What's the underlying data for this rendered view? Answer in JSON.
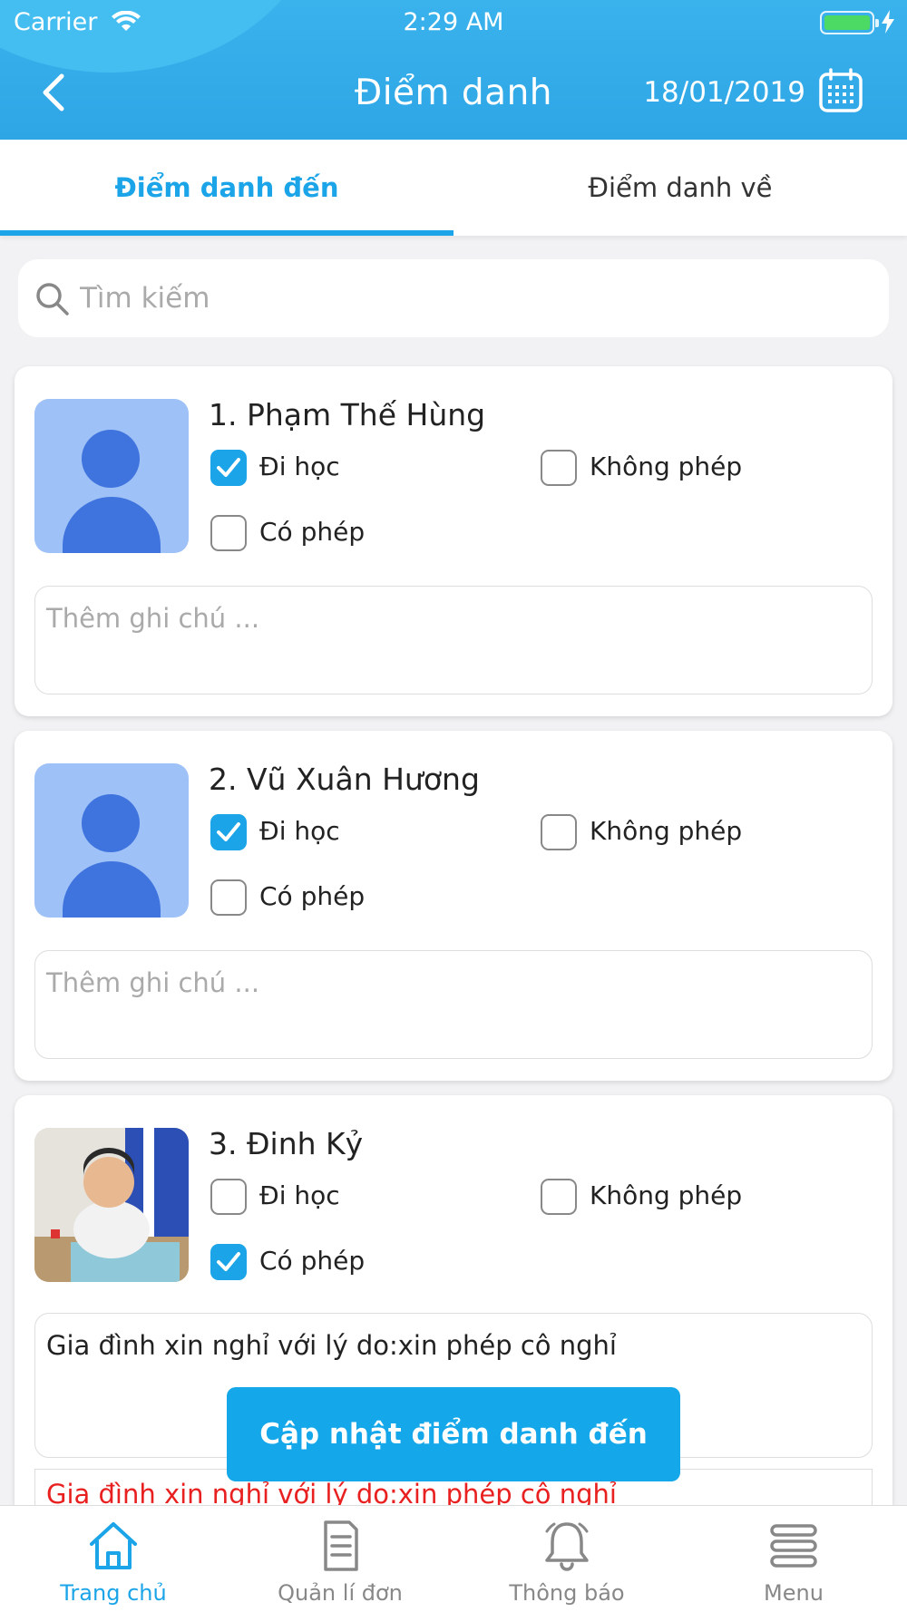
{
  "status_bar": {
    "carrier": "Carrier",
    "time": "2:29 AM"
  },
  "header": {
    "title": "Điểm danh",
    "date": "18/01/2019"
  },
  "tabs": [
    {
      "label": "Điểm danh đến",
      "active": true
    },
    {
      "label": "Điểm danh về",
      "active": false
    }
  ],
  "search": {
    "placeholder": "Tìm kiếm"
  },
  "options": {
    "present": "Đi học",
    "unexcused": "Không phép",
    "excused": "Có phép"
  },
  "note_placeholder": "Thêm ghi chú ...",
  "students": [
    {
      "name": "1. Phạm Thế Hùng",
      "present": true,
      "unexcused": false,
      "excused": false,
      "avatar": "placeholder",
      "note": ""
    },
    {
      "name": "2. Vũ Xuân Hương",
      "present": true,
      "unexcused": false,
      "excused": false,
      "avatar": "placeholder",
      "note": ""
    },
    {
      "name": "3. Đinh Kỷ",
      "present": false,
      "unexcused": false,
      "excused": true,
      "avatar": "photo",
      "note": "Gia đình xin nghỉ với lý do:xin phép cô nghỉ"
    }
  ],
  "reason_text": "Gia đình xin nghỉ với lý do:xin phép cô nghỉ",
  "update_button": "Cập nhật điểm danh đến",
  "tab_bar": [
    {
      "label": "Trang chủ",
      "icon": "home-icon",
      "active": true
    },
    {
      "label": "Quản lí đơn",
      "icon": "document-icon",
      "active": false
    },
    {
      "label": "Thông báo",
      "icon": "bell-icon",
      "active": false
    },
    {
      "label": "Menu",
      "icon": "menu-icon",
      "active": false
    }
  ],
  "colors": {
    "primary": "#1ba5e8",
    "header": "#2ea6e6",
    "avatar_bg": "#9ec1f7",
    "avatar_fg": "#3f73de",
    "error": "#e82020"
  }
}
